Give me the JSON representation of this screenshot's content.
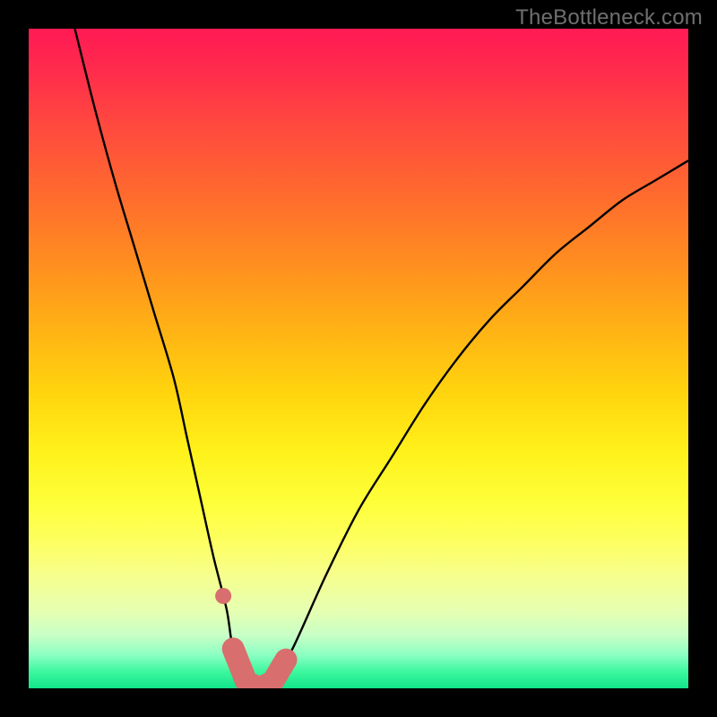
{
  "watermark": "TheBottleneck.com",
  "colors": {
    "frame": "#000000",
    "curve": "#000000",
    "marker": "#d86e6e",
    "gradient_top": "#ff1a54",
    "gradient_bottom": "#12e588"
  },
  "chart_data": {
    "type": "line",
    "title": "",
    "xlabel": "",
    "ylabel": "",
    "xlim": [
      0,
      100
    ],
    "ylim": [
      0,
      100
    ],
    "grid": false,
    "legend": false,
    "note": "Values estimated from pixel positions; y is bottleneck % (0 at bottom / green, 100 at top / red).",
    "series": [
      {
        "name": "bottleneck-curve",
        "x": [
          7,
          10,
          13,
          16,
          19,
          22,
          24,
          26,
          28,
          30,
          31,
          33,
          35,
          37,
          40,
          45,
          50,
          55,
          60,
          65,
          70,
          75,
          80,
          85,
          90,
          95,
          100
        ],
        "y": [
          100,
          88,
          77,
          67,
          57,
          47,
          38,
          29,
          20,
          12,
          6,
          1,
          0,
          1,
          6,
          17,
          27,
          35,
          43,
          50,
          56,
          61,
          66,
          70,
          74,
          77,
          80
        ]
      }
    ],
    "markers": {
      "name": "highlight",
      "comment": "Salmon segment near the minimum, plus one detached dot left of it.",
      "dot": {
        "x": 29.5,
        "y": 14
      },
      "band_x": [
        31,
        39
      ],
      "band_y_approx": 2
    }
  }
}
